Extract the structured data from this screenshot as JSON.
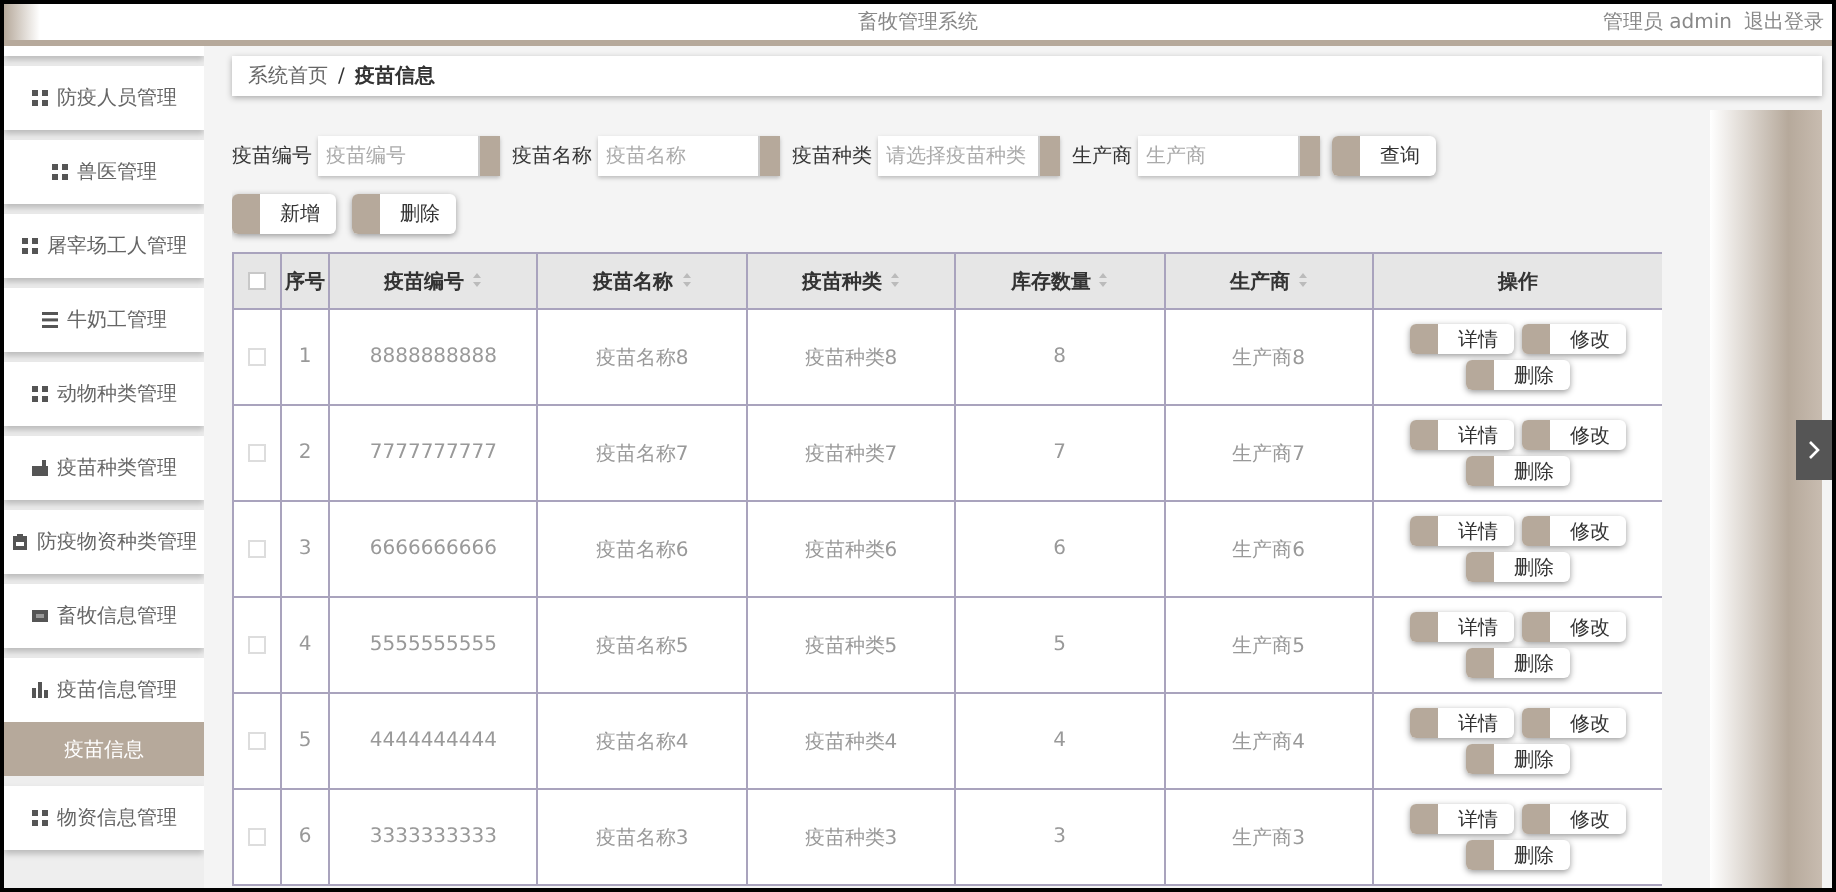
{
  "header": {
    "title": "畜牧管理系统",
    "user": "管理员 admin",
    "logout": "退出登录"
  },
  "sidebar": {
    "items": [
      {
        "label": "防疫人员管理",
        "kind": "grid",
        "selected": false
      },
      {
        "label": "兽医管理",
        "kind": "grid",
        "selected": false
      },
      {
        "label": "屠宰场工人管理",
        "kind": "grid",
        "selected": false
      },
      {
        "label": "牛奶工管理",
        "kind": "list",
        "selected": false
      },
      {
        "label": "动物种类管理",
        "kind": "grid",
        "selected": false
      },
      {
        "label": "疫苗种类管理",
        "kind": "case",
        "selected": false
      },
      {
        "label": "防疫物资种类管理",
        "kind": "clipboard",
        "selected": false
      },
      {
        "label": "畜牧信息管理",
        "kind": "card",
        "selected": false
      },
      {
        "label": "疫苗信息管理",
        "kind": "chart",
        "selected": false
      },
      {
        "label": "疫苗信息",
        "kind": "sub",
        "selected": true
      },
      {
        "label": "物资信息管理",
        "kind": "grid",
        "selected": false
      }
    ]
  },
  "breadcrumb": {
    "items": [
      "系统首页",
      "疫苗信息"
    ],
    "separator": "/"
  },
  "search": {
    "fields": [
      {
        "label": "疫苗编号",
        "placeholder": "疫苗编号"
      },
      {
        "label": "疫苗名称",
        "placeholder": "疫苗名称"
      },
      {
        "label": "疫苗种类",
        "placeholder": "请选择疫苗种类"
      },
      {
        "label": "生产商",
        "placeholder": "生产商"
      }
    ],
    "button": "查询"
  },
  "actions": [
    "新增",
    "删除"
  ],
  "table": {
    "all_checked": false,
    "columns": [
      {
        "label": "序号",
        "sortable": false
      },
      {
        "label": "疫苗编号",
        "sortable": true
      },
      {
        "label": "疫苗名称",
        "sortable": true
      },
      {
        "label": "疫苗种类",
        "sortable": true
      },
      {
        "label": "库存数量",
        "sortable": true
      },
      {
        "label": "生产商",
        "sortable": true
      },
      {
        "label": "操作",
        "sortable": false
      }
    ],
    "rows": [
      {
        "checked": false,
        "cells": [
          "1",
          "8888888888",
          "疫苗名称8",
          "疫苗种类8",
          "8",
          "生产商8"
        ],
        "actions": [
          "详情",
          "修改",
          "删除"
        ]
      },
      {
        "checked": false,
        "cells": [
          "2",
          "7777777777",
          "疫苗名称7",
          "疫苗种类7",
          "7",
          "生产商7"
        ],
        "actions": [
          "详情",
          "修改",
          "删除"
        ]
      },
      {
        "checked": false,
        "cells": [
          "3",
          "6666666666",
          "疫苗名称6",
          "疫苗种类6",
          "6",
          "生产商6"
        ],
        "actions": [
          "详情",
          "修改",
          "删除"
        ]
      },
      {
        "checked": false,
        "cells": [
          "4",
          "5555555555",
          "疫苗名称5",
          "疫苗种类5",
          "5",
          "生产商5"
        ],
        "actions": [
          "详情",
          "修改",
          "删除"
        ]
      },
      {
        "checked": false,
        "cells": [
          "5",
          "4444444444",
          "疫苗名称4",
          "疫苗种类4",
          "4",
          "生产商4"
        ],
        "actions": [
          "详情",
          "修改",
          "删除"
        ]
      },
      {
        "checked": false,
        "cells": [
          "6",
          "3333333333",
          "疫苗名称3",
          "疫苗种类3",
          "3",
          "生产商3"
        ],
        "actions": [
          "详情",
          "修改",
          "删除"
        ]
      }
    ]
  }
}
